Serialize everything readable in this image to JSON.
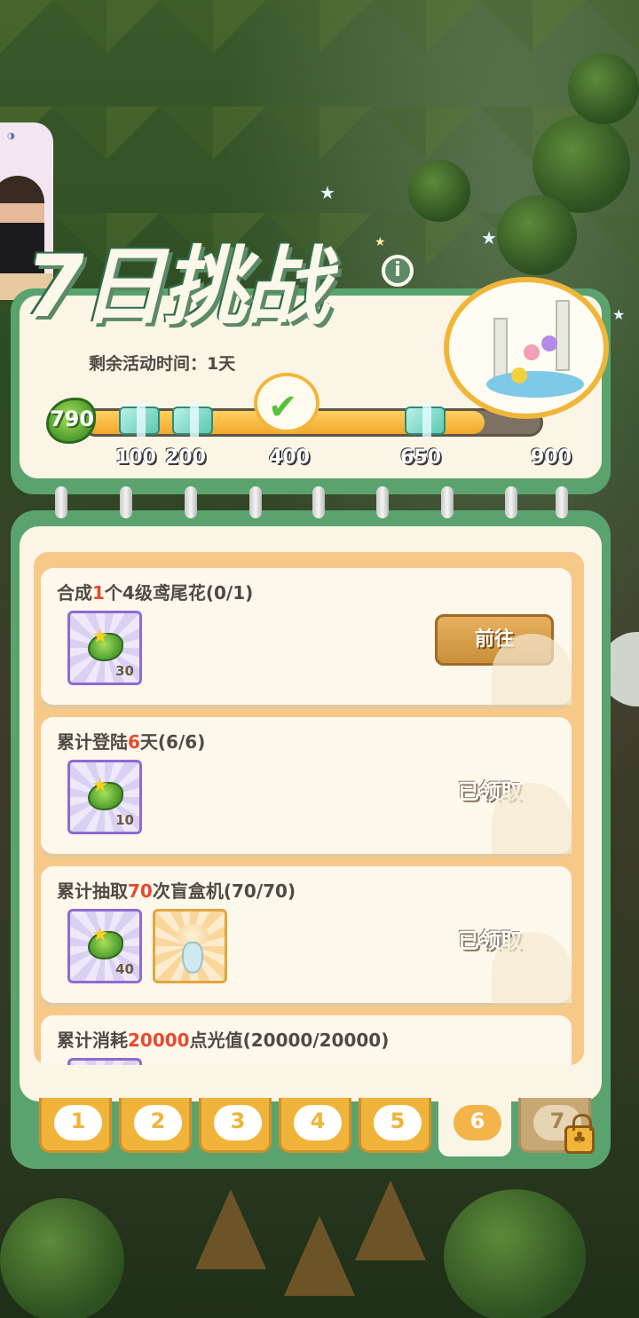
{
  "event": {
    "title": "7日挑战",
    "remaining_time": "剩余活动时间：1天",
    "current_points": "790",
    "progress_fraction": 0.878,
    "milestones": [
      "100",
      "200",
      "400",
      "650",
      "900"
    ]
  },
  "tasks": [
    {
      "title_parts": [
        "合成",
        "1",
        "个4级鸢尾花(0/1)"
      ],
      "rewards": [
        {
          "type": "leaf",
          "qty": "30"
        }
      ],
      "action": "前往"
    },
    {
      "title_parts": [
        "累计登陆",
        "6",
        "天(6/6)"
      ],
      "rewards": [
        {
          "type": "leaf",
          "qty": "10"
        }
      ],
      "status": "已领取"
    },
    {
      "title_parts": [
        "累计抽取",
        "70",
        "次盲盒机(70/70)"
      ],
      "rewards": [
        {
          "type": "leaf",
          "qty": "40"
        },
        {
          "type": "flower-vase"
        }
      ],
      "status": "已领取"
    },
    {
      "title_parts": [
        "累计消耗",
        "20000",
        "点光值(20000/20000)"
      ]
    }
  ],
  "day_tabs": [
    "1",
    "2",
    "3",
    "4",
    "5",
    "6",
    "7"
  ],
  "active_day": "6",
  "locked_day": "7",
  "colors": {
    "panel_green": "#5aa36f",
    "cream": "#fbf5e6",
    "gold": "#f0b43a",
    "highlight_red": "#e84a2c"
  }
}
